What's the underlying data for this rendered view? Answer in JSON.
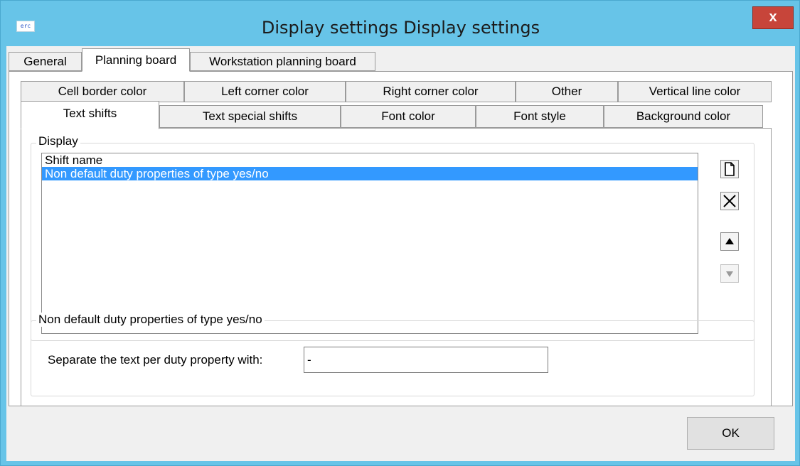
{
  "window": {
    "title": "Display settings Display settings",
    "app_icon_text": "erc",
    "close_label": "x"
  },
  "top_tabs": [
    {
      "label": "General",
      "selected": false
    },
    {
      "label": "Planning board",
      "selected": true
    },
    {
      "label": "Workstation planning board",
      "selected": false
    }
  ],
  "sub_tabs_row1": [
    {
      "label": "Cell border color"
    },
    {
      "label": "Left corner color"
    },
    {
      "label": "Right corner color"
    },
    {
      "label": "Other"
    },
    {
      "label": "Vertical line color"
    }
  ],
  "sub_tabs_row2": [
    {
      "label": "Text shifts",
      "selected": true
    },
    {
      "label": "Text special shifts",
      "selected": false
    },
    {
      "label": "Font color",
      "selected": false
    },
    {
      "label": "Font style",
      "selected": false
    },
    {
      "label": "Background color",
      "selected": false
    }
  ],
  "display_group": {
    "label": "Display",
    "items": [
      {
        "label": "Shift name",
        "selected": false
      },
      {
        "label": "Non default duty properties of type yes/no",
        "selected": true
      }
    ],
    "buttons": [
      {
        "icon": "new-document-icon",
        "glyph": "🗋",
        "enabled": true
      },
      {
        "icon": "delete-x-icon",
        "glyph": "✕",
        "enabled": true
      },
      {
        "icon": "move-up-icon",
        "glyph": "▲",
        "enabled": true
      },
      {
        "icon": "move-down-icon",
        "glyph": "▼",
        "enabled": false
      }
    ]
  },
  "duty_group": {
    "label": "Non default duty properties of type yes/no",
    "separator_label": "Separate the text per duty property with:",
    "separator_value": "-"
  },
  "footer": {
    "ok_label": "OK"
  }
}
